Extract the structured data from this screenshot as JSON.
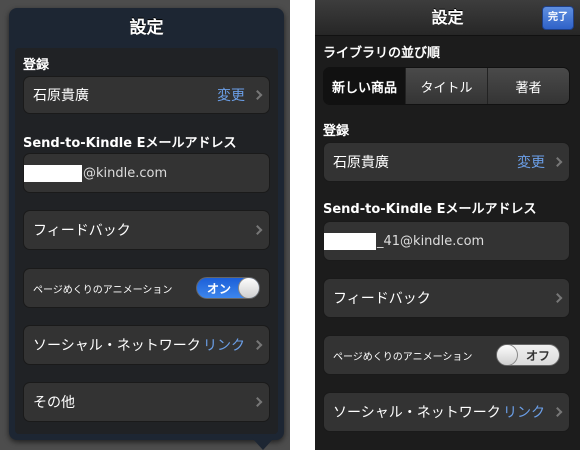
{
  "left": {
    "title": "設定",
    "registration_label": "登録",
    "account_name": "石原貴廣",
    "account_action": "変更",
    "email_section_label": "Send-to-Kindle Eメールアドレス",
    "email_value": "@kindle.com",
    "feedback_label": "フィードバック",
    "animation_label": "ページめくりのアニメーション",
    "animation_toggle": "オン",
    "social_label": "ソーシャル・ネットワーク",
    "social_action": "リンク",
    "other_label": "その他"
  },
  "right": {
    "title": "設定",
    "done_label": "完了",
    "sort_label": "ライブラリの並び順",
    "sort_options": [
      "新しい商品",
      "タイトル",
      "著者"
    ],
    "sort_selected": "新しい商品",
    "registration_label": "登録",
    "account_name": "石原貴廣",
    "account_action": "変更",
    "email_section_label": "Send-to-Kindle Eメールアドレス",
    "email_value": "_41@kindle.com",
    "feedback_label": "フィードバック",
    "animation_label": "ページめくりのアニメーション",
    "animation_toggle": "オフ",
    "social_label": "ソーシャル・ネットワーク",
    "social_action": "リンク"
  },
  "colors": {
    "accent_blue": "#6b9fe8",
    "toggle_on": "#2f74e4",
    "done_button": "#3a6fd6"
  },
  "icons": {
    "disclosure": "chevron-right-icon"
  }
}
